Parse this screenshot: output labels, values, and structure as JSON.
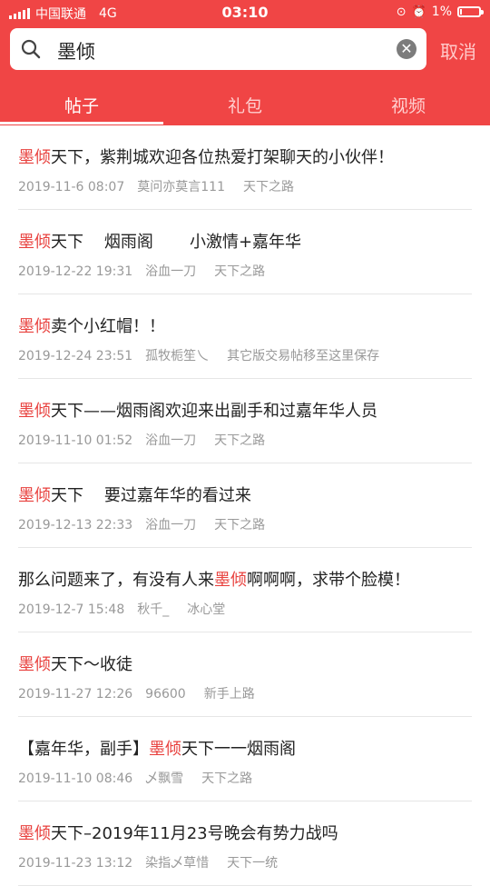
{
  "status_bar": {
    "carrier": "中国联通",
    "network": "4G",
    "time": "03:10",
    "battery": "1%",
    "battery_level": 0.01
  },
  "search": {
    "query": "墨倾",
    "cancel_label": "取消"
  },
  "tabs": [
    {
      "label": "帖子",
      "active": true
    },
    {
      "label": "礼包",
      "active": false
    },
    {
      "label": "视频",
      "active": false
    }
  ],
  "posts": [
    {
      "pre": "",
      "hl": "墨倾",
      "post": "天下，紫荆城欢迎各位热爱打架聊天的小伙伴！",
      "date": "2019-11-6 08:07",
      "author": "莫问亦莫言111",
      "board": "天下之路"
    },
    {
      "pre": "",
      "hl": "墨倾",
      "post": "天下    烟雨阁       小激情+嘉年华",
      "date": "2019-12-22 19:31",
      "author": "浴血一刀",
      "board": "天下之路"
    },
    {
      "pre": "",
      "hl": "墨倾",
      "post": "卖个小红帽！！",
      "date": "2019-12-24 23:51",
      "author": "孤牧栀笙乀",
      "board": "其它版交易帖移至这里保存"
    },
    {
      "pre": "",
      "hl": "墨倾",
      "post": "天下——烟雨阁欢迎来出副手和过嘉年华人员",
      "date": "2019-11-10 01:52",
      "author": "浴血一刀",
      "board": "天下之路"
    },
    {
      "pre": "",
      "hl": "墨倾",
      "post": "天下    要过嘉年华的看过来",
      "date": "2019-12-13 22:33",
      "author": "浴血一刀",
      "board": "天下之路"
    },
    {
      "pre": "那么问题来了，有没有人来",
      "hl": "墨倾",
      "post": "啊啊啊，求带个脸模！",
      "date": "2019-12-7 15:48",
      "author": "秋千_",
      "board": "冰心堂"
    },
    {
      "pre": "",
      "hl": "墨倾",
      "post": "天下～收徒",
      "date": "2019-11-27 12:26",
      "author": "96600",
      "board": "新手上路"
    },
    {
      "pre": "【嘉年华，副手】",
      "hl": "墨倾",
      "post": "天下一一烟雨阁",
      "date": "2019-11-10 08:46",
      "author": "乄飘雪",
      "board": "天下之路"
    },
    {
      "pre": "",
      "hl": "墨倾",
      "post": "天下–2019年11月23号晚会有势力战吗",
      "date": "2019-11-23 13:12",
      "author": "染指乄草惜",
      "board": "天下一统"
    }
  ]
}
